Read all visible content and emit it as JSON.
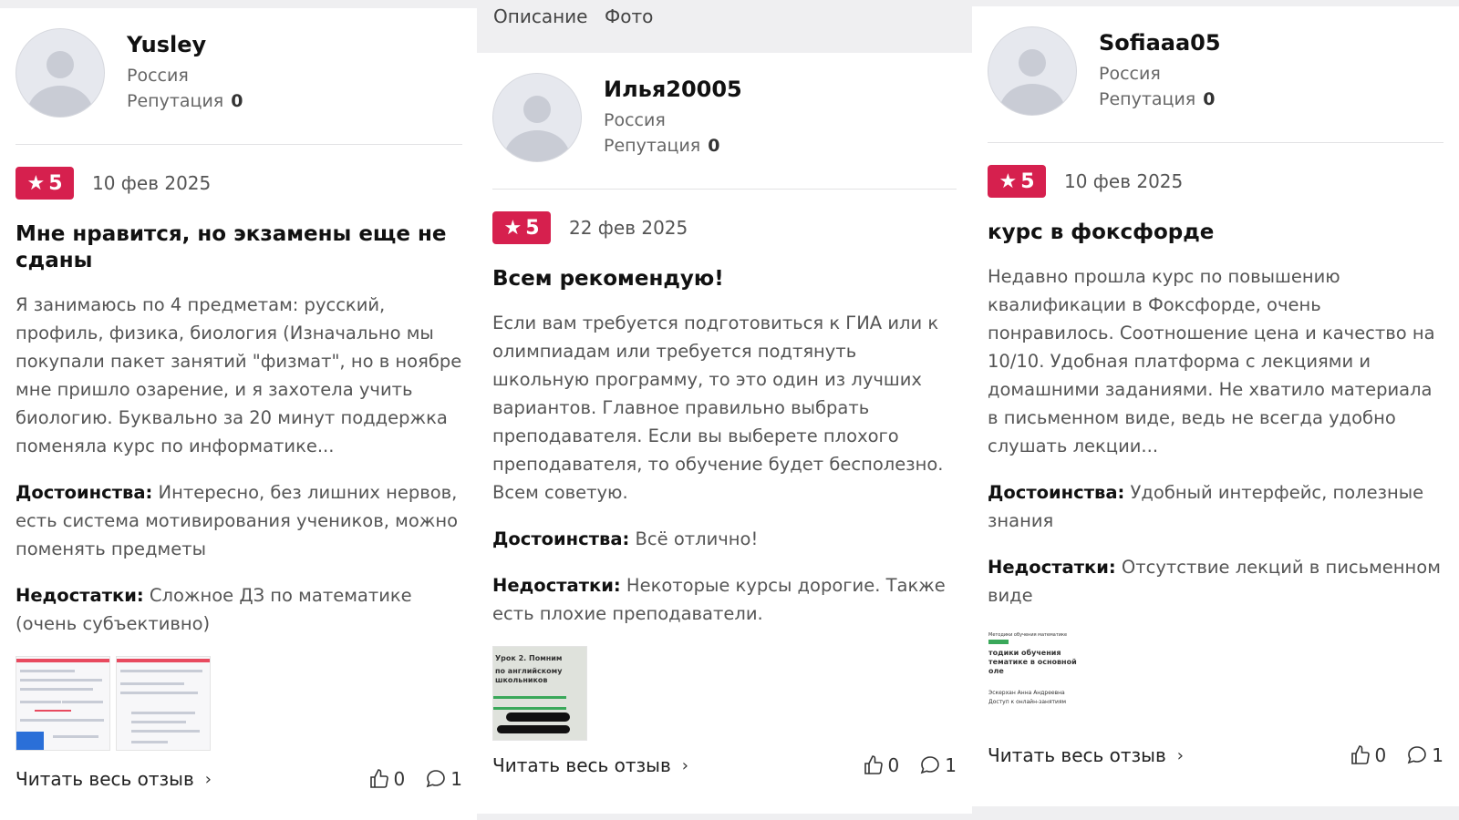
{
  "tabs": [
    "Описание",
    "Фото"
  ],
  "reviews": [
    {
      "user": "Yusley",
      "country": "Россия",
      "rep_label": "Репутация",
      "rep_value": "0",
      "rating": "5",
      "date": "10 фев 2025",
      "title": "Мне нравится, но экзамены еще не сданы",
      "text": "Я занимаюсь по 4 предметам: русский, профиль, физика, биология (Изначально мы покупали пакет занятий \"физмат\", но в ноябре мне пришло озарение, и я захотела учить биологию. Буквально за 20 минут поддержка поменяла курс по информатике...",
      "pros_label": "Достоинства:",
      "pros": "Интересно, без лишних нервов, есть система мотивирования учеников, можно поменять предметы",
      "cons_label": "Недостатки:",
      "cons": "Сложное ДЗ по математике (очень субъективно)",
      "read_more": "Читать весь отзыв",
      "likes": "0",
      "comments": "1"
    },
    {
      "user": "Илья20005",
      "country": "Россия",
      "rep_label": "Репутация",
      "rep_value": "0",
      "rating": "5",
      "date": "22 фев 2025",
      "title": "Всем рекомендую!",
      "text": "Если вам требуется подготовиться к ГИА или к олимпиадам или требуется подтянуть школьную программу, то это один из лучших вариантов. Главное правильно выбрать преподавателя. Если вы выберете плохого преподавателя, то обучение будет бесполезно. Всем советую.",
      "pros_label": "Достоинства:",
      "pros": "Всё отлично!",
      "cons_label": "Недостатки:",
      "cons": "Некоторые курсы дорогие. Также есть плохие преподаватели.",
      "read_more": "Читать весь отзыв",
      "likes": "0",
      "comments": "1"
    },
    {
      "user": "Sofiaaa05",
      "country": "Россия",
      "rep_label": "Репутация",
      "rep_value": "0",
      "rating": "5",
      "date": "10 фев 2025",
      "title": "курс в фоксфорде",
      "text": "Недавно прошла курс по повышению квалификации в Фоксфорде, очень понравилось. Соотношение цена и качество на 10/10. Удобная платформа с лекциями и домашними заданиями. Не хватило материала в письменном виде, ведь не всегда удобно слушать лекции...",
      "pros_label": "Достоинства:",
      "pros": "Удобный интерфейс, полезные знания",
      "cons_label": "Недостатки:",
      "cons": "Отсутствие лекций в письменном виде",
      "read_more": "Читать весь отзыв",
      "likes": "0",
      "comments": "1"
    }
  ],
  "thumb_texts": {
    "photo1": [
      "Урок 2. Помним",
      "по английскому",
      "школьников"
    ],
    "photo2": [
      "Методики обучения математике",
      "тодики обучения",
      "тематике в основной",
      "оле",
      "Эскерхан Анна Андреевна",
      "Доступ к онлайн-занятиям"
    ]
  },
  "colors": {
    "badge": "#d6204e",
    "page_bg": "#efeff1"
  }
}
